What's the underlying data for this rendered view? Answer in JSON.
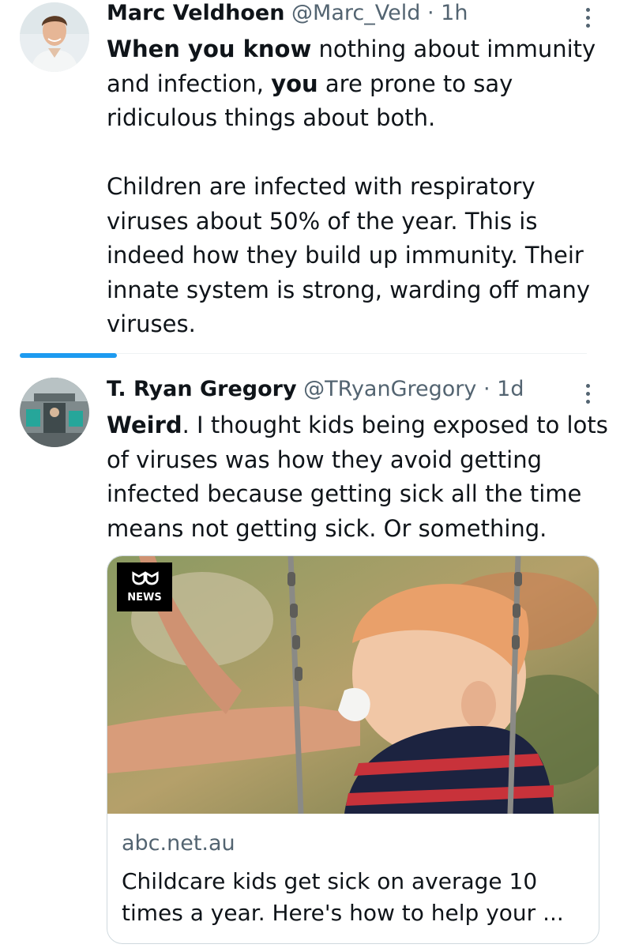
{
  "tweets": [
    {
      "author": "Marc Veldhoen",
      "handle": "@Marc_Veld",
      "separator": "·",
      "time": "1h",
      "body": {
        "bold1": "When you know",
        "text1": " nothing about immunity and infection, ",
        "bold2": "you",
        "text2": " are prone to say ridiculous things about both.",
        "paragraph2": "Children are infected with respiratory viruses about 50% of the year. This is indeed how they build up immunity. Their innate system is strong, warding off many viruses."
      }
    },
    {
      "author": "T. Ryan Gregory",
      "handle": "@TRyanGregory",
      "separator": "·",
      "time": "1d",
      "body": {
        "bold1": "Weird",
        "text1": ". I thought kids being exposed to lots of viruses was how they avoid getting infected because getting sick all the time means not getting sick. Or something."
      },
      "card": {
        "logo_text": "NEWS",
        "domain": "abc.net.au",
        "title": "Childcare kids get sick on average 10 times a year. Here's how to help your ..."
      }
    }
  ],
  "colors": {
    "accent": "#1d9bf0",
    "secondary_text": "#536471",
    "primary_text": "#0f1419",
    "border": "#cfd9de"
  },
  "icons": [
    "more-vertical-icon",
    "abc-news-logo"
  ]
}
